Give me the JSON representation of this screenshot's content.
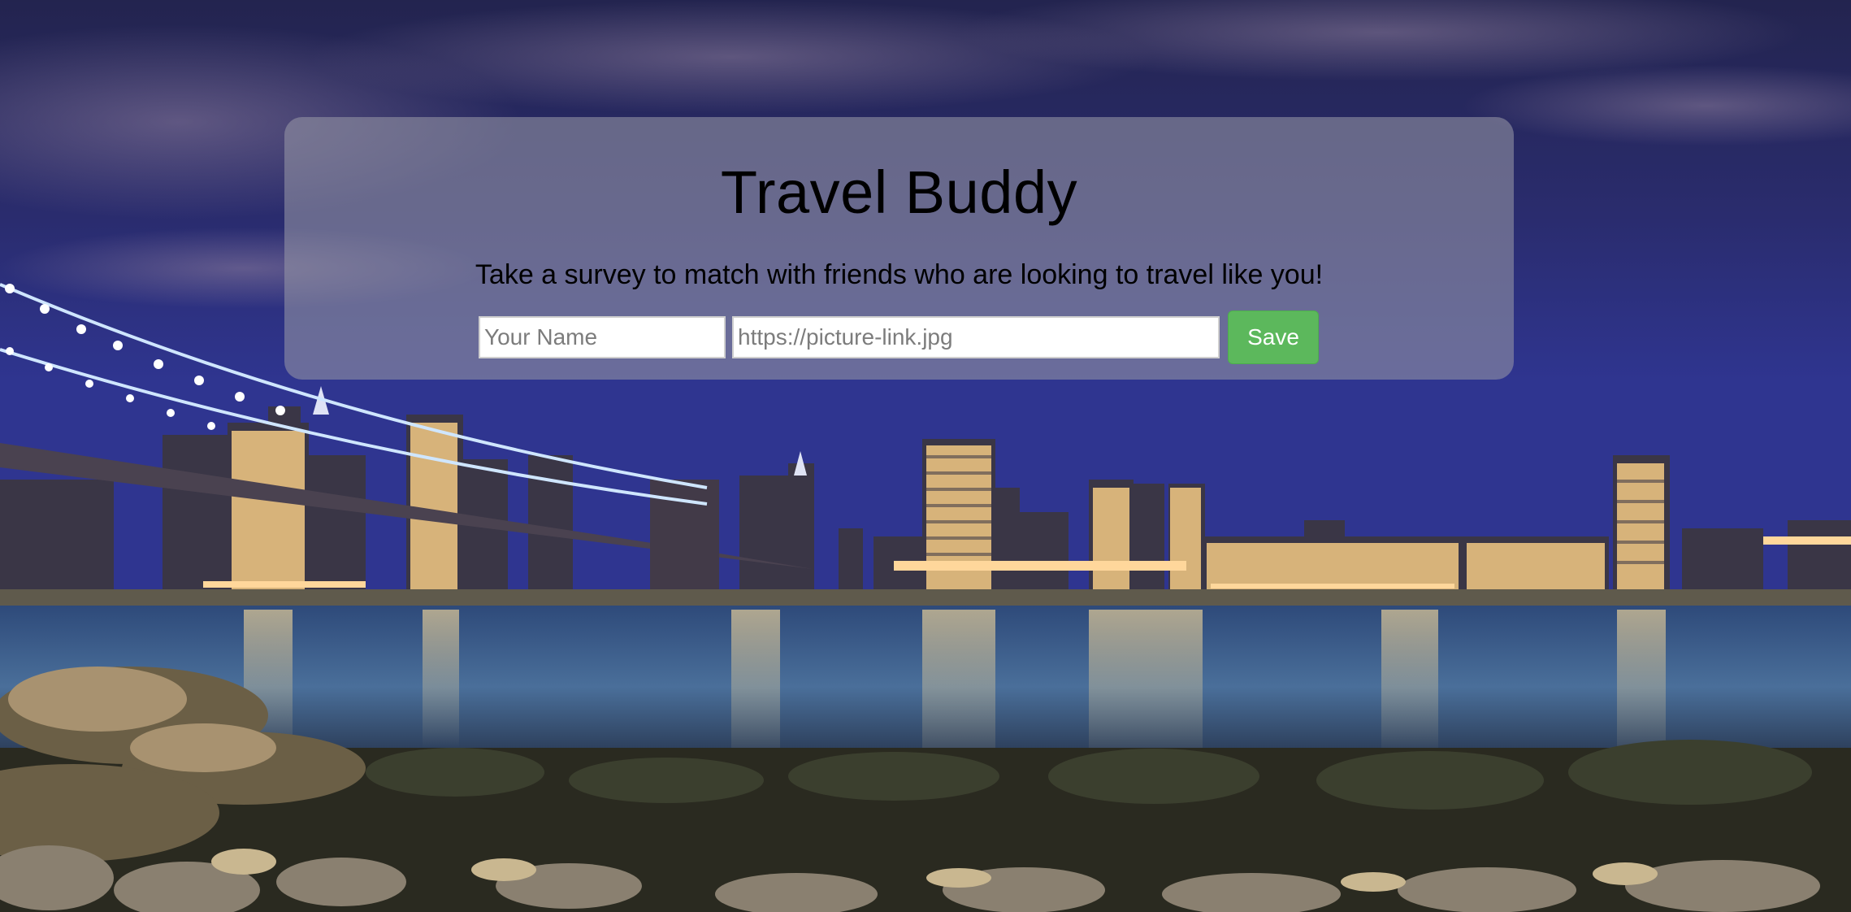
{
  "header": {
    "title": "Travel Buddy",
    "subtitle": "Take a survey to match with friends who are looking to travel like you!"
  },
  "form": {
    "name_placeholder": "Your Name",
    "name_value": "",
    "photo_placeholder": "https://picture-link.jpg",
    "photo_value": "",
    "save_label": "Save"
  },
  "colors": {
    "card_overlay": "#9696a5",
    "save_button": "#5cb85c",
    "sky": "#1f1f5a"
  },
  "background": {
    "subject": "night-city-skyline-with-bridge"
  }
}
